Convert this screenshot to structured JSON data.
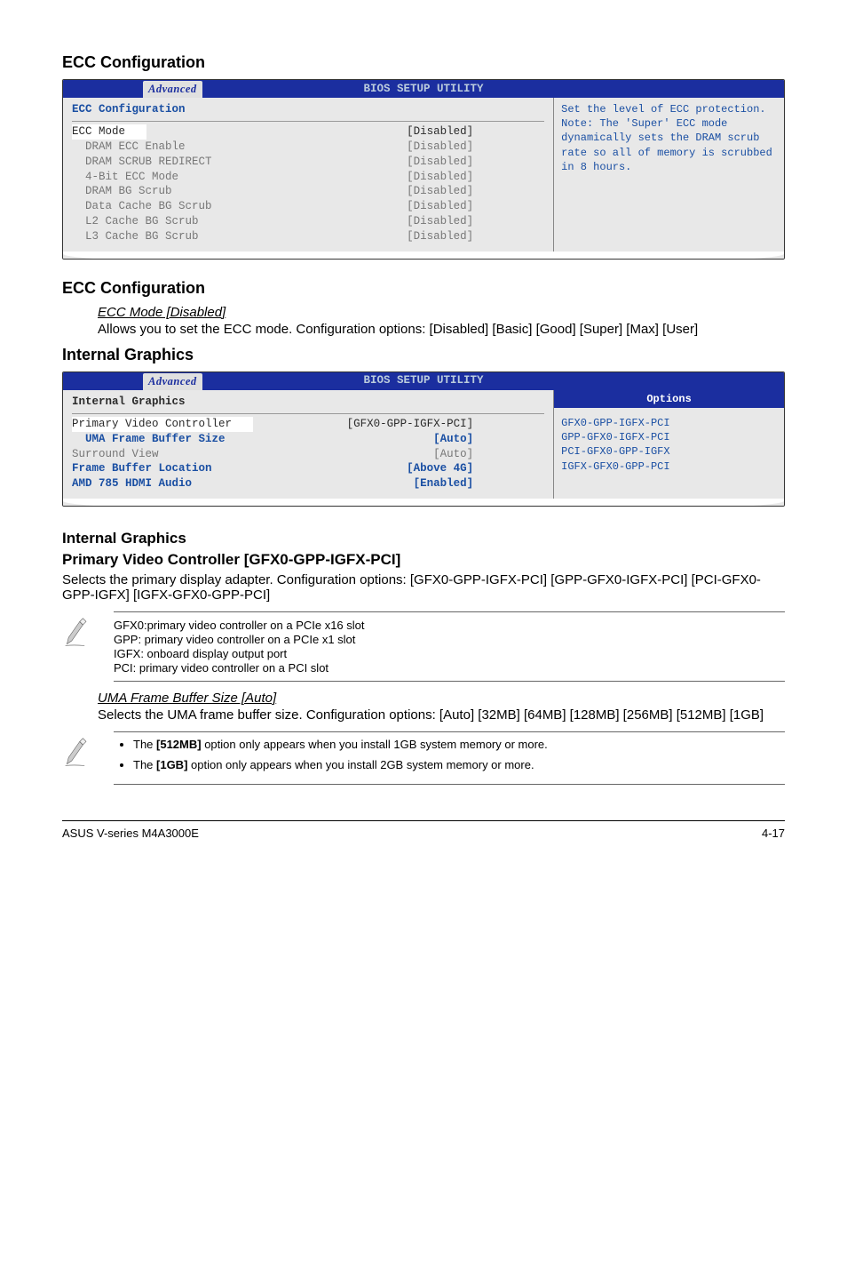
{
  "section1_title": "ECC Configuration",
  "bios_title": "BIOS SETUP UTILITY",
  "bios_tab": "Advanced",
  "bios1": {
    "left_title": "ECC Configuration",
    "rows": [
      {
        "label": "ECC Mode",
        "value": "[Disabled]",
        "selected": true
      },
      {
        "label": "  DRAM ECC Enable",
        "value": "[Disabled]"
      },
      {
        "label": "  DRAM SCRUB REDIRECT",
        "value": "[Disabled]"
      },
      {
        "label": "  4-Bit ECC Mode",
        "value": "[Disabled]"
      },
      {
        "label": "  DRAM BG Scrub",
        "value": "[Disabled]"
      },
      {
        "label": "  Data Cache BG Scrub",
        "value": "[Disabled]"
      },
      {
        "label": "  L2 Cache BG Scrub",
        "value": "[Disabled]"
      },
      {
        "label": "  L3 Cache BG Scrub",
        "value": "[Disabled]"
      }
    ],
    "right_text": "Set the level of ECC protection. Note: The 'Super' ECC mode dynamically sets the DRAM scrub rate so all of memory is scrubbed in 8 hours."
  },
  "section2_title": "ECC Configuration",
  "ecc_mode_title": "ECC Mode [Disabled]",
  "ecc_mode_body": "Allows you to set the ECC mode. Configuration options: [Disabled] [Basic] [Good] [Super] [Max] [User]",
  "section3_title": "Internal Graphics",
  "bios2": {
    "left_title": "Internal Graphics",
    "rows": [
      {
        "label": "Primary Video Controller",
        "value": "[GFX0-GPP-IGFX-PCI]",
        "selected": true
      },
      {
        "label": "  UMA Frame Buffer Size",
        "value": "[Auto]",
        "blue": true
      },
      {
        "label": "Surround View",
        "value": "[Auto]"
      },
      {
        "label": "Frame Buffer Location",
        "value": "[Above 4G]",
        "blue": true
      },
      {
        "label": "AMD 785 HDMI Audio",
        "value": "[Enabled]",
        "blue": true
      }
    ],
    "options_header": "Options",
    "right_options": [
      "GFX0-GPP-IGFX-PCI",
      "GPP-GFX0-IGFX-PCI",
      "PCI-GFX0-GPP-IGFX",
      "IGFX-GFX0-GPP-PCI"
    ]
  },
  "section4_title": "Internal Graphics",
  "pvc_title": "Primary Video Controller [GFX0-GPP-IGFX-PCI]",
  "pvc_body": "Selects the primary display adapter. Configuration options: [GFX0-GPP-IGFX-PCI] [GPP-GFX0-IGFX-PCI] [PCI-GFX0-GPP-IGFX] [IGFX-GFX0-GPP-PCI]",
  "glossary": {
    "l1": "GFX0:primary video controller on a PCIe x16 slot",
    "l2": "GPP:  primary video controller on a PCIe x1 slot",
    "l3": "IGFX: onboard display output port",
    "l4": "PCI:   primary video controller on a PCI slot"
  },
  "uma_title": "UMA Frame Buffer Size [Auto]",
  "uma_body": "Selects the UMA frame buffer size. Configuration options: [Auto] [32MB] [64MB] [128MB] [256MB] [512MB] [1GB]",
  "note_512_a": "The ",
  "note_512_b": "[512MB]",
  "note_512_c": " option only appears when you install 1GB system memory or more.",
  "note_1g_a": "The ",
  "note_1g_b": "[1GB]",
  "note_1g_c": " option only appears when you install 2GB system memory or more.",
  "footer_left": "ASUS V-series M4A3000E",
  "footer_right": "4-17"
}
